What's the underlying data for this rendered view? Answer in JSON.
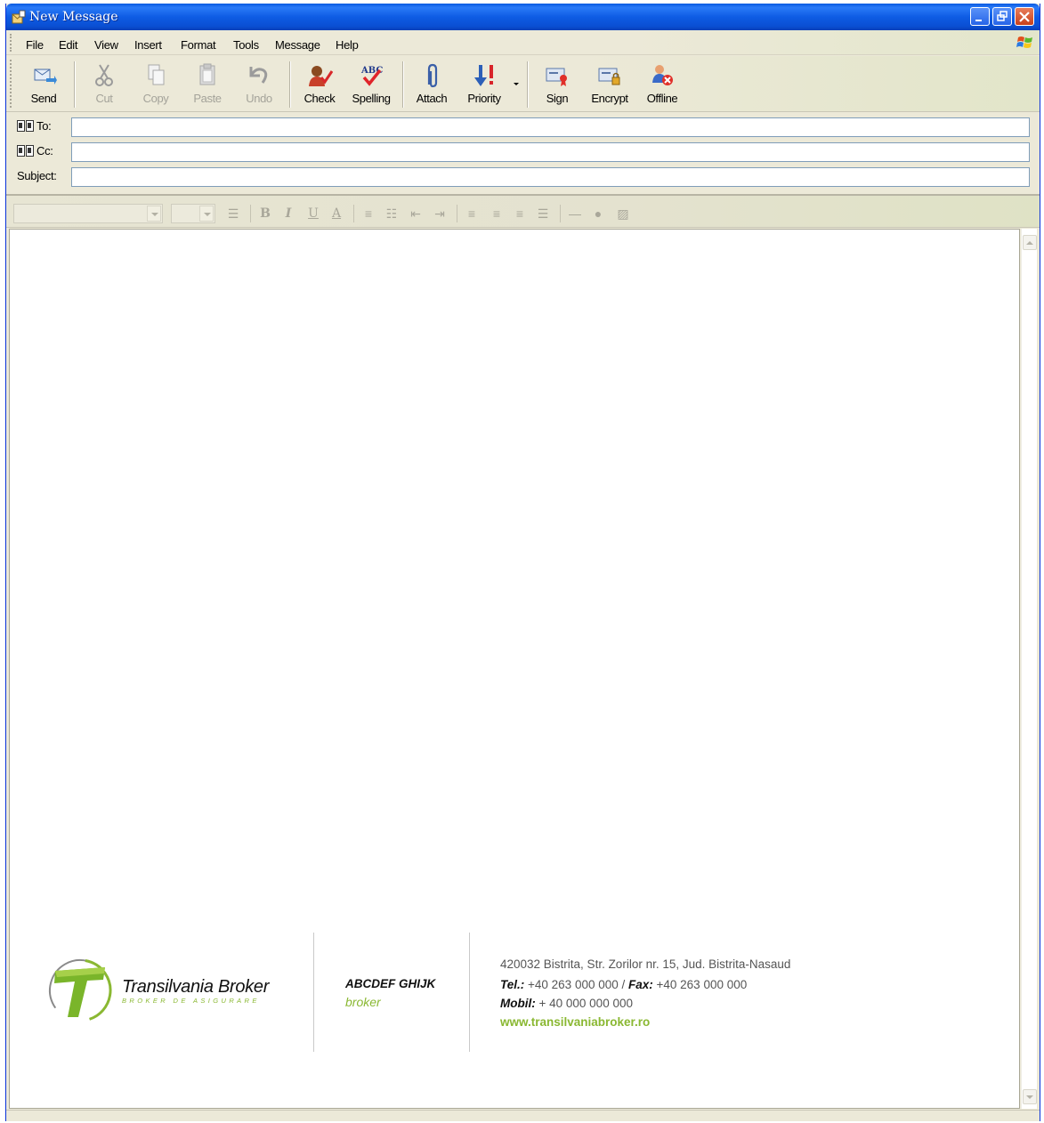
{
  "window": {
    "title": "New Message"
  },
  "menu": {
    "items": [
      "File",
      "Edit",
      "View",
      "Insert",
      "Format",
      "Tools",
      "Message",
      "Help"
    ]
  },
  "toolbar": {
    "send": "Send",
    "cut": "Cut",
    "copy": "Copy",
    "paste": "Paste",
    "undo": "Undo",
    "check": "Check",
    "spelling": "Spelling",
    "spelling_icon_text": "ABC",
    "attach": "Attach",
    "priority": "Priority",
    "sign": "Sign",
    "encrypt": "Encrypt",
    "offline": "Offline"
  },
  "fields": {
    "to_label": "To:",
    "cc_label": "Cc:",
    "subject_label": "Subject:",
    "to_value": "",
    "cc_value": "",
    "subject_value": ""
  },
  "format_bar": {
    "font": "",
    "size": "",
    "bold_glyph": "B",
    "italic_glyph": "I",
    "underline_glyph": "U",
    "color_glyph": "A"
  },
  "signature": {
    "brand": "Transilvania Broker",
    "tagline": "BROKER DE ASIGURARE",
    "person_name": "ABCDEF GHIJK",
    "person_role": "broker",
    "address": "420032 Bistrita, Str. Zorilor nr. 15, Jud. Bistrita-Nasaud",
    "tel_label": "Tel.:",
    "tel_value": " +40 263 000 000 / ",
    "fax_label": "Fax:",
    "fax_value": " +40 263 000 000",
    "mobil_label": "Mobil:",
    "mobil_value": " + 40 000 000 000",
    "website": "www.transilvaniabroker.ro"
  },
  "colors": {
    "titlebar": "#0a5ae0",
    "brand_green": "#8ab832",
    "chrome": "#ece9d8"
  }
}
